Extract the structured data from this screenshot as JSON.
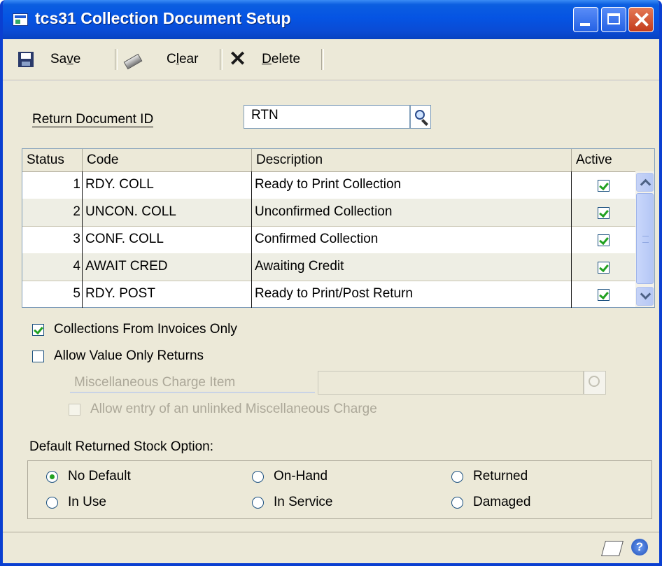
{
  "window": {
    "title": "tcs31 Collection Document Setup"
  },
  "toolbar": {
    "save_pre": "Sa",
    "save_key": "v",
    "save_post": "e",
    "clear_pre": "C",
    "clear_key": "l",
    "clear_post": "ear",
    "delete_key": "D",
    "delete_post": "elete"
  },
  "return_document": {
    "label": "Return Document ID",
    "value": "RTN"
  },
  "grid": {
    "headers": [
      "Status",
      "Code",
      "Description",
      "Active"
    ],
    "rows": [
      {
        "status": "1",
        "code": "RDY. COLL",
        "description": "Ready to Print Collection",
        "active": true
      },
      {
        "status": "2",
        "code": "UNCON. COLL",
        "description": "Unconfirmed Collection",
        "active": true
      },
      {
        "status": "3",
        "code": "CONF. COLL",
        "description": "Confirmed Collection",
        "active": true
      },
      {
        "status": "4",
        "code": "AWAIT CRED",
        "description": "Awaiting Credit",
        "active": true
      },
      {
        "status": "5",
        "code": "RDY. POST",
        "description": "Ready to Print/Post Return",
        "active": true
      }
    ]
  },
  "options": {
    "collections_from_invoices_only": {
      "label": "Collections From Invoices Only",
      "checked": true
    },
    "allow_value_only_returns": {
      "label": "Allow Value Only Returns",
      "checked": false
    },
    "misc_charge_item": {
      "label": "Miscellaneous Charge Item",
      "value": "",
      "enabled": false
    },
    "allow_unlinked_misc": {
      "label": "Allow entry of an unlinked Miscellaneous Charge",
      "checked": false,
      "enabled": false
    }
  },
  "stock_option": {
    "label": "Default Returned Stock Option:",
    "selected": "No Default",
    "choices": [
      "No Default",
      "On-Hand",
      "Returned",
      "In Use",
      "In Service",
      "Damaged"
    ]
  },
  "colors": {
    "titlebar": "#0554e3",
    "window_bg": "#ece9d8",
    "check_green": "#21a121"
  }
}
